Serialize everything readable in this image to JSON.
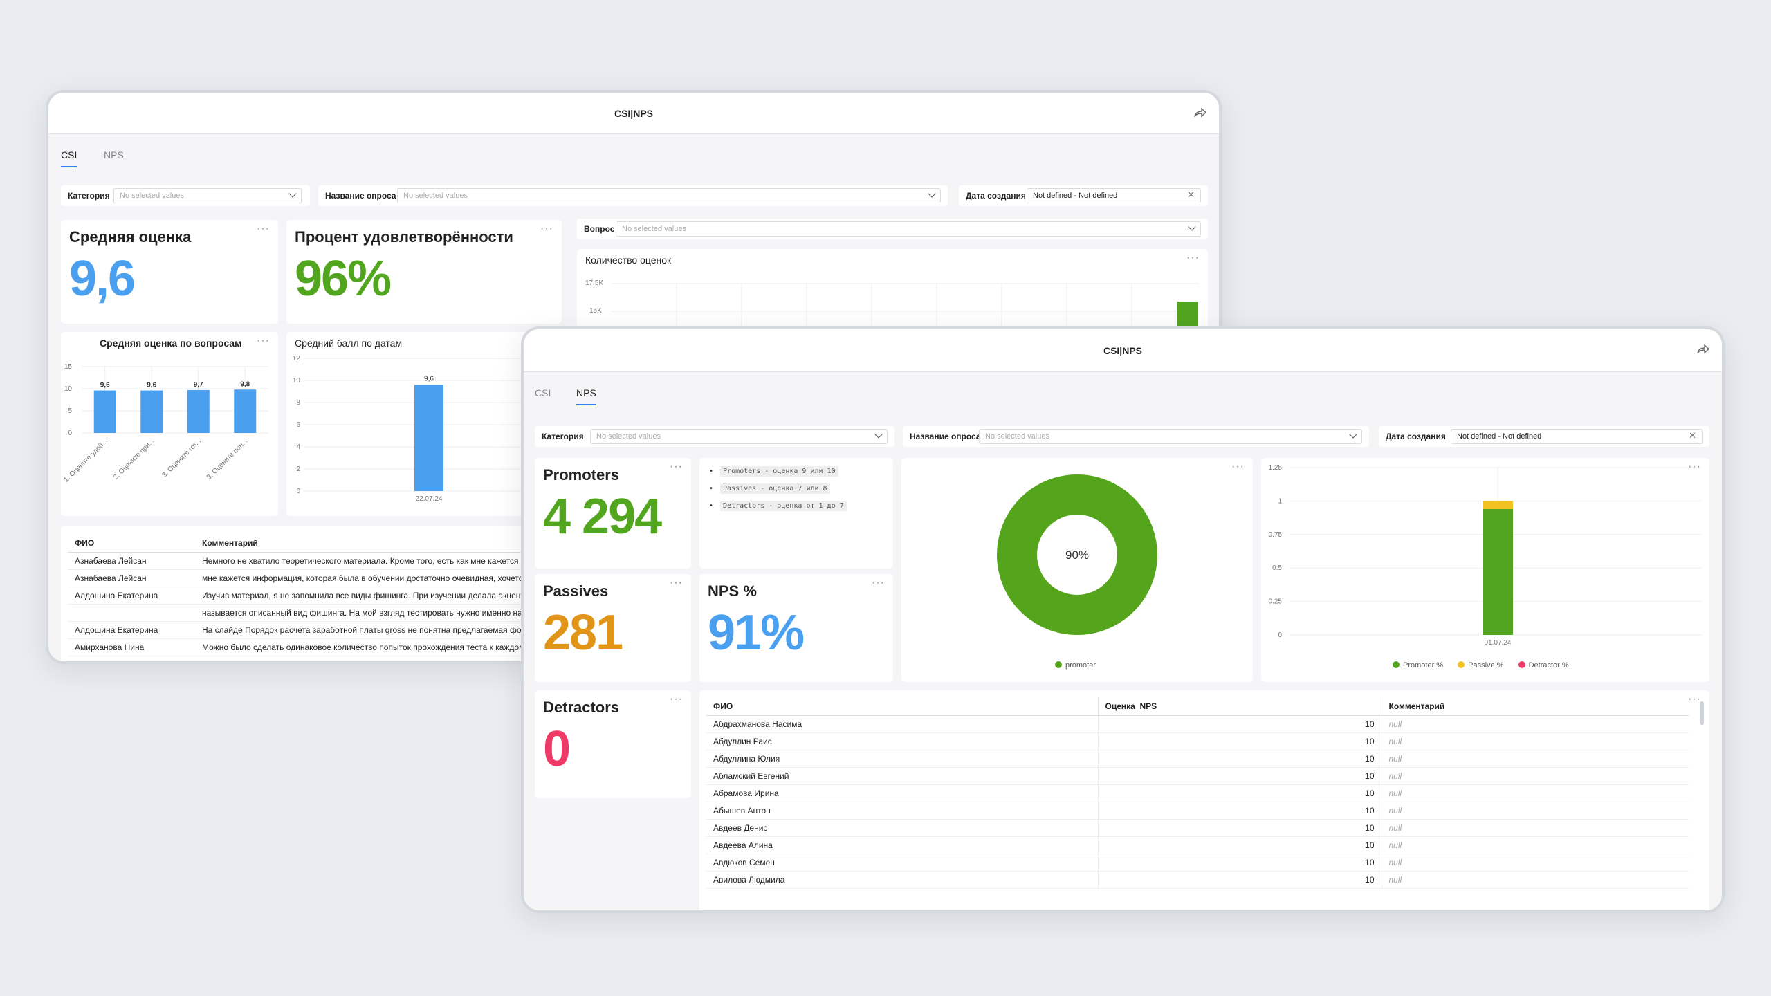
{
  "app_title": "CSI|NPS",
  "tabs": [
    "CSI",
    "NPS"
  ],
  "colors": {
    "blue": "#4a9fef",
    "green": "#52a51f",
    "orange": "#e09418",
    "red": "#ef3a68",
    "donut": "#55a51c",
    "yellow": "#f2c320",
    "tab_underline": "#3d7cf5"
  },
  "icons": [
    "share-icon",
    "chevron-down-icon",
    "close-icon",
    "more-dots-icon"
  ],
  "back": {
    "filters": {
      "category": {
        "label": "Категория",
        "placeholder": "No selected values"
      },
      "survey": {
        "label": "Название опроса",
        "placeholder": "No selected values"
      },
      "date": {
        "label": "Дата создания",
        "value": "Not defined - Not defined"
      },
      "question": {
        "label": "Вопрос",
        "placeholder": "No selected values"
      }
    },
    "avg_score": {
      "title": "Средняя оценка",
      "value": "9,6"
    },
    "satisfaction": {
      "title": "Процент удовлетворённости",
      "value": "96%"
    },
    "count_chart": {
      "title": "Количество оценок",
      "ticks": [
        "17.5K",
        "15K"
      ],
      "type": "bar"
    },
    "by_question": {
      "title": "Средняя оценка по вопросам",
      "type": "bar",
      "y_ticks": [
        "15",
        "10",
        "5",
        "0"
      ],
      "ylim": [
        0,
        15
      ],
      "categories": [
        "1. Оцените удоб...",
        "2. Оцените при...",
        "3. Оцените гот...",
        "3. Оцените пон..."
      ],
      "values": [
        9.6,
        9.6,
        9.7,
        9.8
      ],
      "labels": [
        "9,6",
        "9,6",
        "9,7",
        "9,8"
      ]
    },
    "by_date": {
      "title": "Средний балл по датам",
      "type": "bar",
      "y_ticks": [
        "12",
        "10",
        "8",
        "6",
        "4",
        "2",
        "0"
      ],
      "ylim": [
        0,
        12
      ],
      "categories": [
        "22.07.24"
      ],
      "values": [
        9.6
      ],
      "labels": [
        "9,6"
      ]
    },
    "comments": {
      "headers": [
        "ФИО",
        "Комментарий"
      ],
      "rows": [
        [
          "Азнабаева Лейсан",
          "Немного не хватило теоретического материала. Кроме того, есть как мне кажется не"
        ],
        [
          "Азнабаева Лейсан",
          "мне кажется информация, которая была в обучении достаточно очевидная, хочется б"
        ],
        [
          "Алдошина Екатерина",
          "Изучив материал, я не запомнила все виды фишинга. При изучении делала акцент на"
        ],
        [
          "",
          "называется описанный вид фишинга. На мой взгляд тестировать нужно именно на п"
        ],
        [
          "Алдошина Екатерина",
          "На слайде Порядок расчета заработной платы gross не понятна предлагаемая форму"
        ],
        [
          "Амирханова Нина",
          "Можно было сделать одинаковое количество попыток прохождения теста к каждому"
        ]
      ]
    }
  },
  "front": {
    "filters": {
      "category": {
        "label": "Категория",
        "placeholder": "No selected values"
      },
      "survey": {
        "label": "Название опроса",
        "placeholder": "No selected values"
      },
      "date": {
        "label": "Дата создания",
        "value": "Not defined - Not defined"
      }
    },
    "promoters": {
      "title": "Promoters",
      "value": "4 294"
    },
    "passives": {
      "title": "Passives",
      "value": "281"
    },
    "nps": {
      "title": "NPS %",
      "value": "91%"
    },
    "detractors": {
      "title": "Detractors",
      "value": "0"
    },
    "definitions": [
      "Promoters - оценка 9 или 10",
      "Passives - оценка 7 или 8",
      "Detractors - оценка от 1 до 7"
    ],
    "donut": {
      "center_label": "90%",
      "legend": "promoter"
    },
    "stacked": {
      "y_ticks": [
        "1.25",
        "1",
        "0.75",
        "0.5",
        "0.25",
        "0"
      ],
      "x_label": "01.07.24",
      "legend": [
        "Promoter %",
        "Passive %",
        "Detractor %"
      ]
    },
    "chart_data": [
      {
        "type": "pie",
        "labels": [
          "promoter"
        ],
        "values": [
          0.9
        ],
        "center_label": "90%"
      },
      {
        "type": "bar",
        "stacked": true,
        "categories": [
          "01.07.24"
        ],
        "ylim": [
          0,
          1.25
        ],
        "series": [
          {
            "name": "Promoter %",
            "values": [
              0.94
            ]
          },
          {
            "name": "Passive %",
            "values": [
              0.06
            ]
          },
          {
            "name": "Detractor %",
            "values": [
              0
            ]
          }
        ]
      }
    ],
    "table": {
      "headers": [
        "ФИО",
        "Оценка_NPS",
        "Комментарий"
      ],
      "rows": [
        [
          "Абдрахманова Насима",
          "10",
          "null"
        ],
        [
          "Абдуллин Раис",
          "10",
          "null"
        ],
        [
          "Абдуллина Юлия",
          "10",
          "null"
        ],
        [
          "Абламский Евгений",
          "10",
          "null"
        ],
        [
          "Абрамова Ирина",
          "10",
          "null"
        ],
        [
          "Абышев Антон",
          "10",
          "null"
        ],
        [
          "Авдеев Денис",
          "10",
          "null"
        ],
        [
          "Авдеева Алина",
          "10",
          "null"
        ],
        [
          "Авдюков Семен",
          "10",
          "null"
        ],
        [
          "Авилова Людмила",
          "10",
          "null"
        ]
      ]
    }
  }
}
